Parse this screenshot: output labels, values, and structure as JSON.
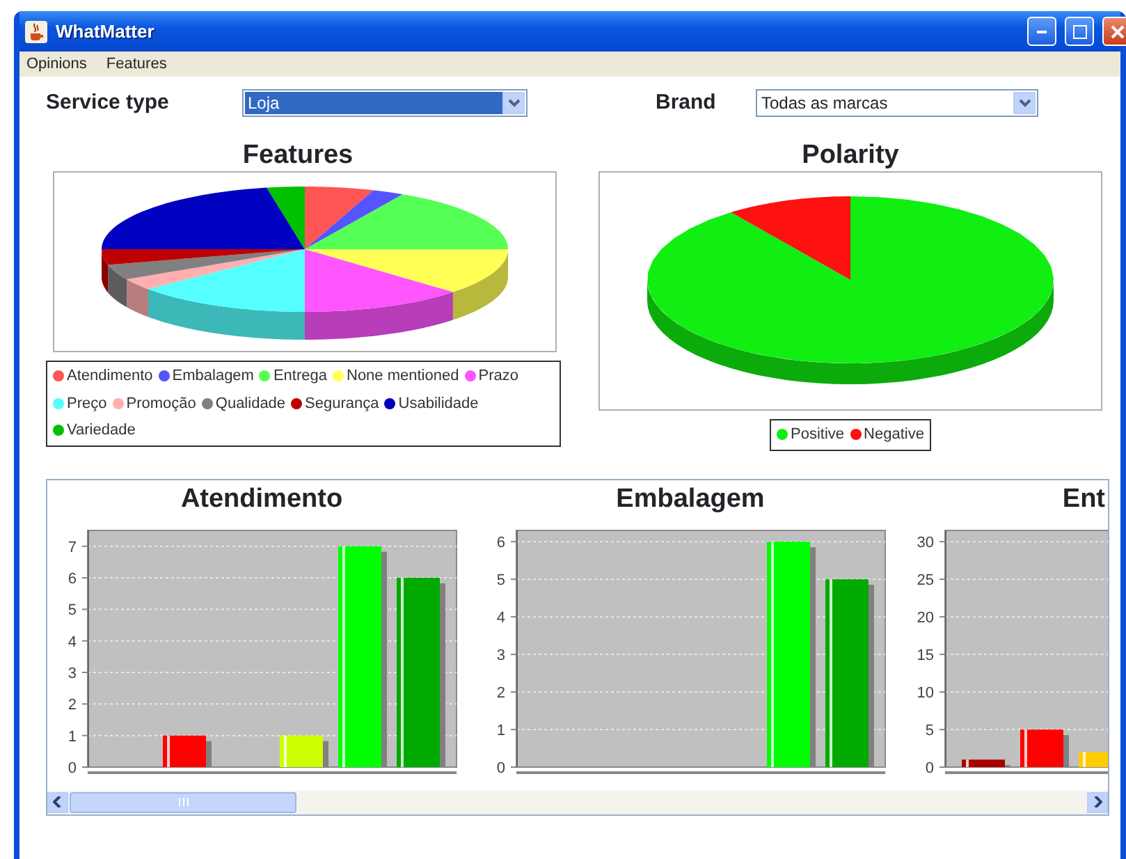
{
  "window": {
    "title": "WhatMatter"
  },
  "menu": [
    "Opinions",
    "Features"
  ],
  "filters": [
    {
      "label": "Service type",
      "value": "Loja",
      "selected": true
    },
    {
      "label": "Brand",
      "value": "Todas as marcas",
      "selected": false
    }
  ],
  "features_chart": {
    "title": "Features",
    "legend": [
      {
        "label": "Atendimento",
        "color": "#ff5555"
      },
      {
        "label": "Embalagem",
        "color": "#5555ff"
      },
      {
        "label": "Entrega",
        "color": "#55ff55"
      },
      {
        "label": "None mentioned",
        "color": "#ffff55"
      },
      {
        "label": "Prazo",
        "color": "#ff55ff"
      },
      {
        "label": "Preço",
        "color": "#55ffff"
      },
      {
        "label": "Promoção",
        "color": "#ffafaf"
      },
      {
        "label": "Qualidade",
        "color": "#808080"
      },
      {
        "label": "Segurança",
        "color": "#c00000"
      },
      {
        "label": "Usabilidade",
        "color": "#0000c0"
      },
      {
        "label": "Variedade",
        "color": "#00c000"
      }
    ]
  },
  "polarity_chart": {
    "title": "Polarity",
    "legend": [
      {
        "label": "Positive",
        "color": "#11ee11"
      },
      {
        "label": "Negative",
        "color": "#ff1111"
      }
    ]
  },
  "bar_charts": [
    {
      "title": "Atendimento",
      "chart_data": {
        "type": "bar",
        "grid": true,
        "ylim": [
          0,
          7.5
        ],
        "yticks": [
          0,
          1,
          2,
          3,
          4,
          5,
          6,
          7
        ],
        "series": [
          {
            "values": [
              0
            ]
          },
          {
            "color": "#ff0000",
            "values": [
              1
            ]
          },
          {
            "values": [
              0
            ]
          },
          {
            "color": "#ccff00",
            "values": [
              1
            ]
          },
          {
            "color": "#00ff00",
            "values": [
              7
            ]
          },
          {
            "color": "#00aa00",
            "values": [
              6
            ]
          }
        ]
      }
    },
    {
      "title": "Embalagem",
      "chart_data": {
        "type": "bar",
        "grid": true,
        "ylim": [
          0,
          6.3
        ],
        "yticks": [
          0,
          1,
          2,
          3,
          4,
          5,
          6
        ],
        "series": [
          {
            "values": [
              0
            ]
          },
          {
            "values": [
              0
            ]
          },
          {
            "values": [
              0
            ]
          },
          {
            "values": [
              0
            ]
          },
          {
            "color": "#00ff00",
            "values": [
              6
            ]
          },
          {
            "color": "#00aa00",
            "values": [
              5
            ]
          }
        ]
      }
    },
    {
      "title": "Ent",
      "chart_data": {
        "type": "bar",
        "grid": true,
        "ylim": [
          0,
          31.5
        ],
        "yticks": [
          0,
          5,
          10,
          15,
          20,
          25,
          30
        ],
        "series": [
          {
            "color": "#aa0000",
            "values": [
              1
            ]
          },
          {
            "color": "#ff0000",
            "values": [
              5
            ]
          },
          {
            "color": "#ffcc00",
            "values": [
              2
            ]
          }
        ]
      }
    }
  ]
}
